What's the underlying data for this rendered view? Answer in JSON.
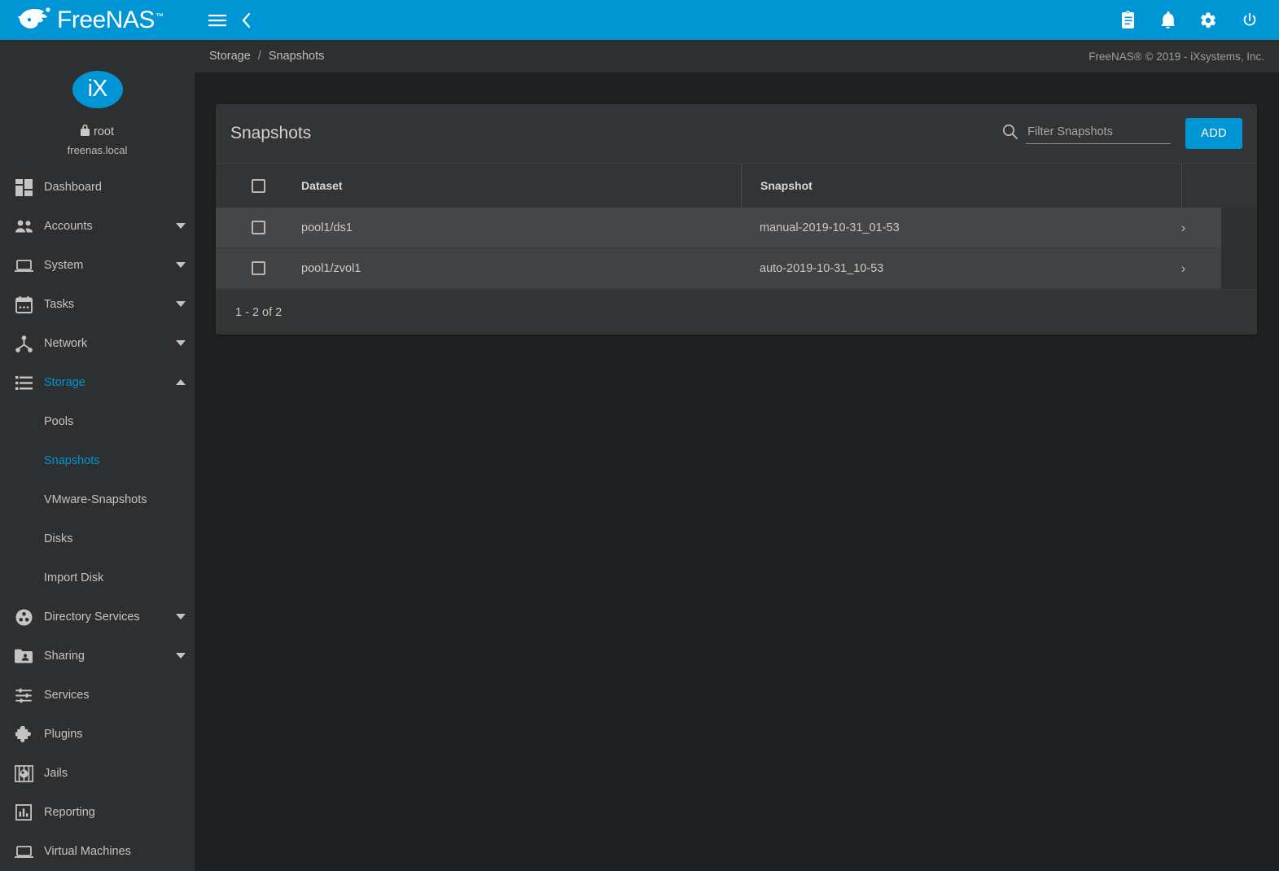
{
  "app": {
    "brand_name": "FreeNAS",
    "brand_tm": "™",
    "theme_accent": "#0095d5",
    "sidebar_bg": "#2e2f30",
    "body_bg": "#1f2021",
    "card_bg": "#333435"
  },
  "topbar": {
    "menu_icon": "hamburger-menu-icon",
    "back_icon": "chevron-left-icon",
    "right_icons": [
      {
        "name": "tasks-clipboard-icon",
        "label": "Task Manager"
      },
      {
        "name": "notifications-bell-icon",
        "label": "Alerts"
      },
      {
        "name": "settings-gear-icon",
        "label": "Settings"
      },
      {
        "name": "power-icon",
        "label": "Power"
      }
    ]
  },
  "sidebar": {
    "user": {
      "logo_text": "iX",
      "lock_icon": "lock-icon",
      "username": "root",
      "hostname": "freenas.local"
    },
    "items": [
      {
        "label": "Dashboard",
        "icon": "dashboard-icon",
        "caret": "",
        "active": false
      },
      {
        "label": "Accounts",
        "icon": "accounts-people-icon",
        "caret": "down",
        "active": false
      },
      {
        "label": "System",
        "icon": "system-laptop-icon",
        "caret": "down",
        "active": false
      },
      {
        "label": "Tasks",
        "icon": "tasks-calendar-icon",
        "caret": "down",
        "active": false
      },
      {
        "label": "Network",
        "icon": "network-nodes-icon",
        "caret": "down",
        "active": false
      },
      {
        "label": "Storage",
        "icon": "storage-stack-icon",
        "caret": "up",
        "active": true
      }
    ],
    "storage_children": [
      {
        "label": "Pools",
        "active": false
      },
      {
        "label": "Snapshots",
        "active": true
      },
      {
        "label": "VMware-Snapshots",
        "active": false
      },
      {
        "label": "Disks",
        "active": false
      },
      {
        "label": "Import Disk",
        "active": false
      }
    ],
    "items_after": [
      {
        "label": "Directory Services",
        "icon": "directory-services-icon",
        "caret": "down",
        "active": false
      },
      {
        "label": "Sharing",
        "icon": "sharing-folder-icon",
        "caret": "down",
        "active": false
      },
      {
        "label": "Services",
        "icon": "services-sliders-icon",
        "caret": "",
        "active": false
      },
      {
        "label": "Plugins",
        "icon": "plugins-puzzle-icon",
        "caret": "",
        "active": false
      },
      {
        "label": "Jails",
        "icon": "jails-icon",
        "caret": "",
        "active": false
      },
      {
        "label": "Reporting",
        "icon": "reporting-chart-icon",
        "caret": "",
        "active": false
      },
      {
        "label": "Virtual Machines",
        "icon": "virtual-machines-icon",
        "caret": "",
        "active": false
      }
    ]
  },
  "breadcrumb": {
    "items": [
      "Storage",
      "Snapshots"
    ],
    "separator": "/",
    "parent": "Storage",
    "current": "Snapshots"
  },
  "copyright": "FreeNAS® © 2019 - iXsystems, Inc.",
  "card": {
    "title": "Snapshots",
    "search": {
      "icon": "search-icon",
      "placeholder": "Filter Snapshots",
      "value": ""
    },
    "add_label": "ADD"
  },
  "table": {
    "columns": [
      {
        "key": "select",
        "label": ""
      },
      {
        "key": "dataset",
        "label": "Dataset"
      },
      {
        "key": "snapshot",
        "label": "Snapshot"
      },
      {
        "key": "expand",
        "label": ""
      }
    ],
    "header_checkbox_checked": false,
    "expand_icon": "chevron-right-icon",
    "rows": [
      {
        "dataset": "pool1/ds1",
        "snapshot": "manual-2019-10-31_01-53",
        "checked": false,
        "expand": "›"
      },
      {
        "dataset": "pool1/zvol1",
        "snapshot": "auto-2019-10-31_10-53",
        "checked": false,
        "expand": "›"
      }
    ],
    "footer": "1 - 2 of 2"
  }
}
